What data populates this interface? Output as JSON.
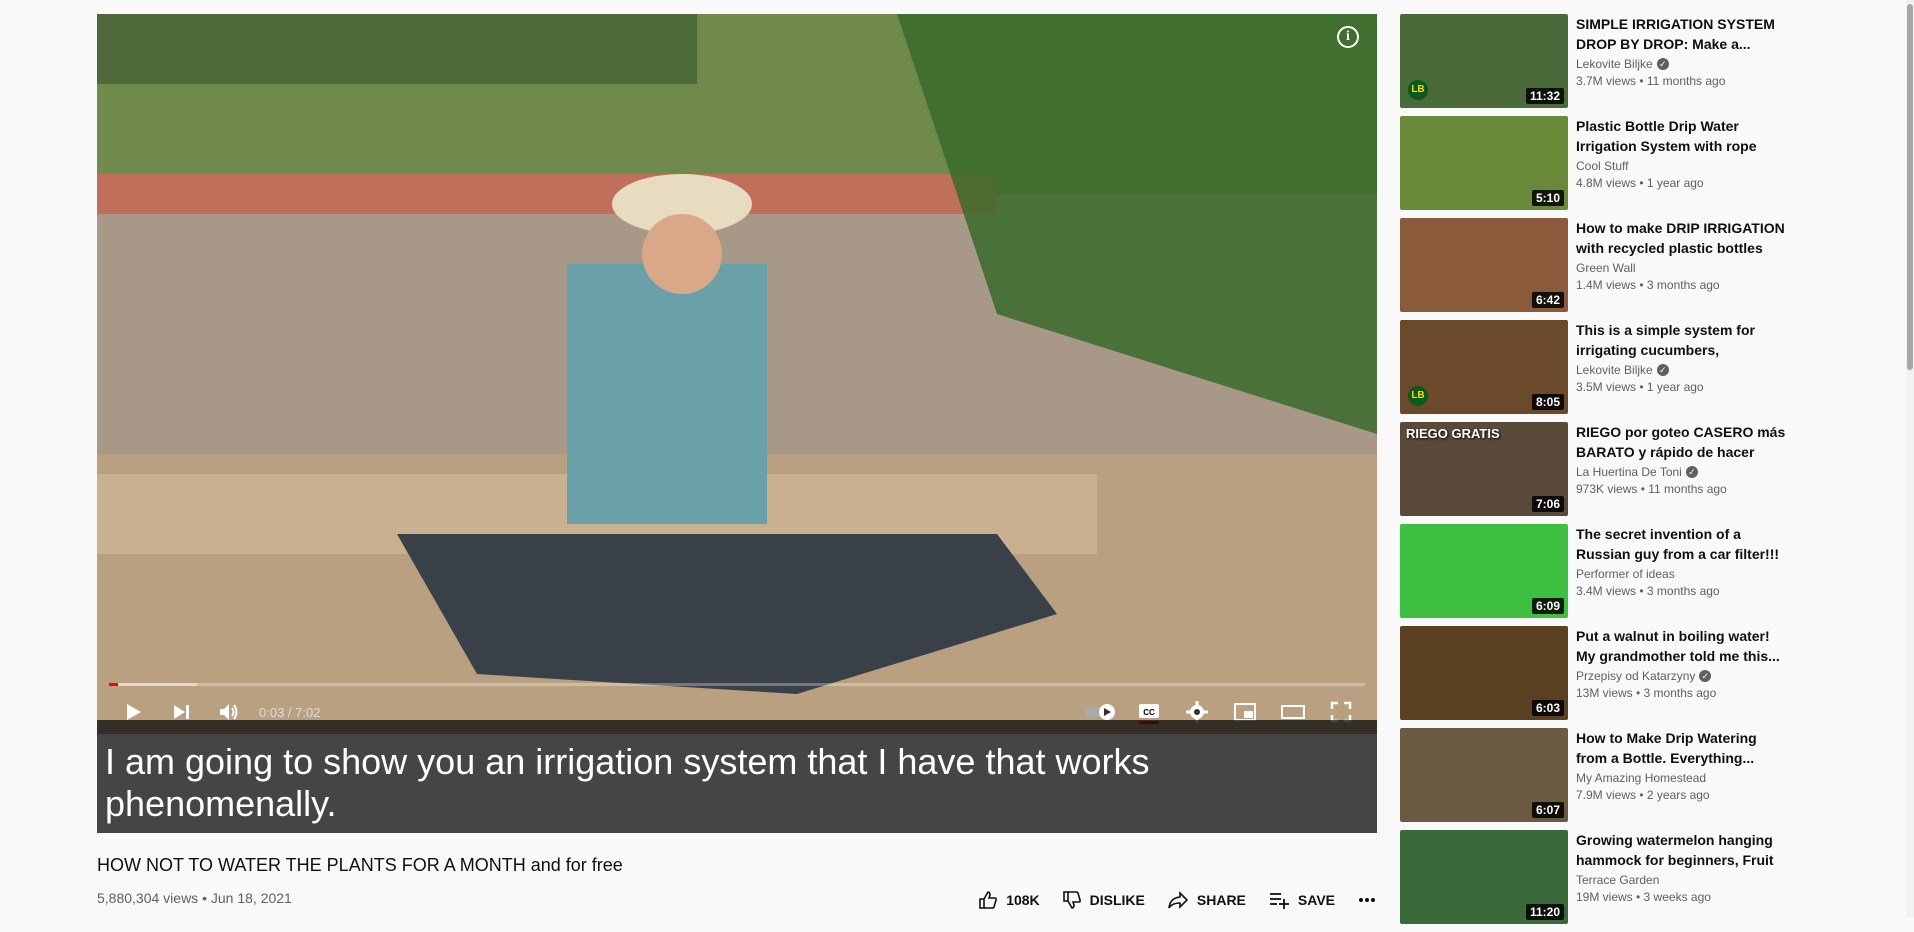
{
  "player": {
    "current_time": "0:03",
    "duration": "7:02",
    "time_separator": " / ",
    "progress_fraction": 0.007,
    "buffer_fraction": 0.07
  },
  "caption": "I am going to show you an irrigation system that I have that works phenomenally.",
  "video": {
    "title": "HOW NOT TO WATER THE PLANTS FOR A MONTH and for free",
    "views": "5,880,304 views",
    "date": "Jun 18, 2021",
    "meta_sep": " • "
  },
  "actions": {
    "like": "108K",
    "dislike": "DISLIKE",
    "share": "SHARE",
    "save": "SAVE"
  },
  "recommendations": [
    {
      "title": "SIMPLE IRRIGATION SYSTEM DROP BY DROP: Make a...",
      "channel": "Lekovite Biljke",
      "verified": true,
      "stats": "3.7M views • 11 months ago",
      "duration": "11:32",
      "color": "#4a6a3a",
      "badge": "LB"
    },
    {
      "title": "Plastic Bottle Drip Water Irrigation System with rope Ve...",
      "channel": "Cool Stuff",
      "verified": false,
      "stats": "4.8M views • 1 year ago",
      "duration": "5:10",
      "color": "#6a8a3a"
    },
    {
      "title": "How to make DRIP IRRIGATION with recycled plastic bottles",
      "channel": "Green Wall",
      "verified": false,
      "stats": "1.4M views • 3 months ago",
      "duration": "6:42",
      "color": "#8a5a3a"
    },
    {
      "title": "This is a simple system for irrigating cucumbers, tomatoe...",
      "channel": "Lekovite Biljke",
      "verified": true,
      "stats": "3.5M views • 1 year ago",
      "duration": "8:05",
      "color": "#6a4a2a",
      "badge": "LB"
    },
    {
      "title": "RIEGO por goteo CASERO más BARATO y rápido de hacer Co...",
      "channel": "La Huertina De Toni",
      "verified": true,
      "stats": "973K views • 11 months ago",
      "duration": "7:06",
      "color": "#5a4a3a",
      "overlay": "RIEGO GRATIS"
    },
    {
      "title": "The secret invention of a Russian guy from a car filter!!!",
      "channel": "Performer of ideas",
      "verified": false,
      "stats": "3.4M views • 3 months ago",
      "duration": "6:09",
      "color": "#3fbf3f"
    },
    {
      "title": "Put a walnut in boiling water! My grandmother told me this...",
      "channel": "Przepisy od Katarzyny",
      "verified": true,
      "stats": "13M views • 3 months ago",
      "duration": "6:03",
      "color": "#5a4020"
    },
    {
      "title": "How to Make Drip Watering from a Bottle. Everything...",
      "channel": "My Amazing Homestead",
      "verified": false,
      "stats": "7.9M views • 2 years ago",
      "duration": "6:07",
      "color": "#6a5a40"
    },
    {
      "title": "Growing watermelon hanging hammock for beginners, Fruit i...",
      "channel": "Terrace Garden",
      "verified": false,
      "stats": "19M views • 3 weeks ago",
      "duration": "11:20",
      "color": "#3a6a3a"
    }
  ]
}
